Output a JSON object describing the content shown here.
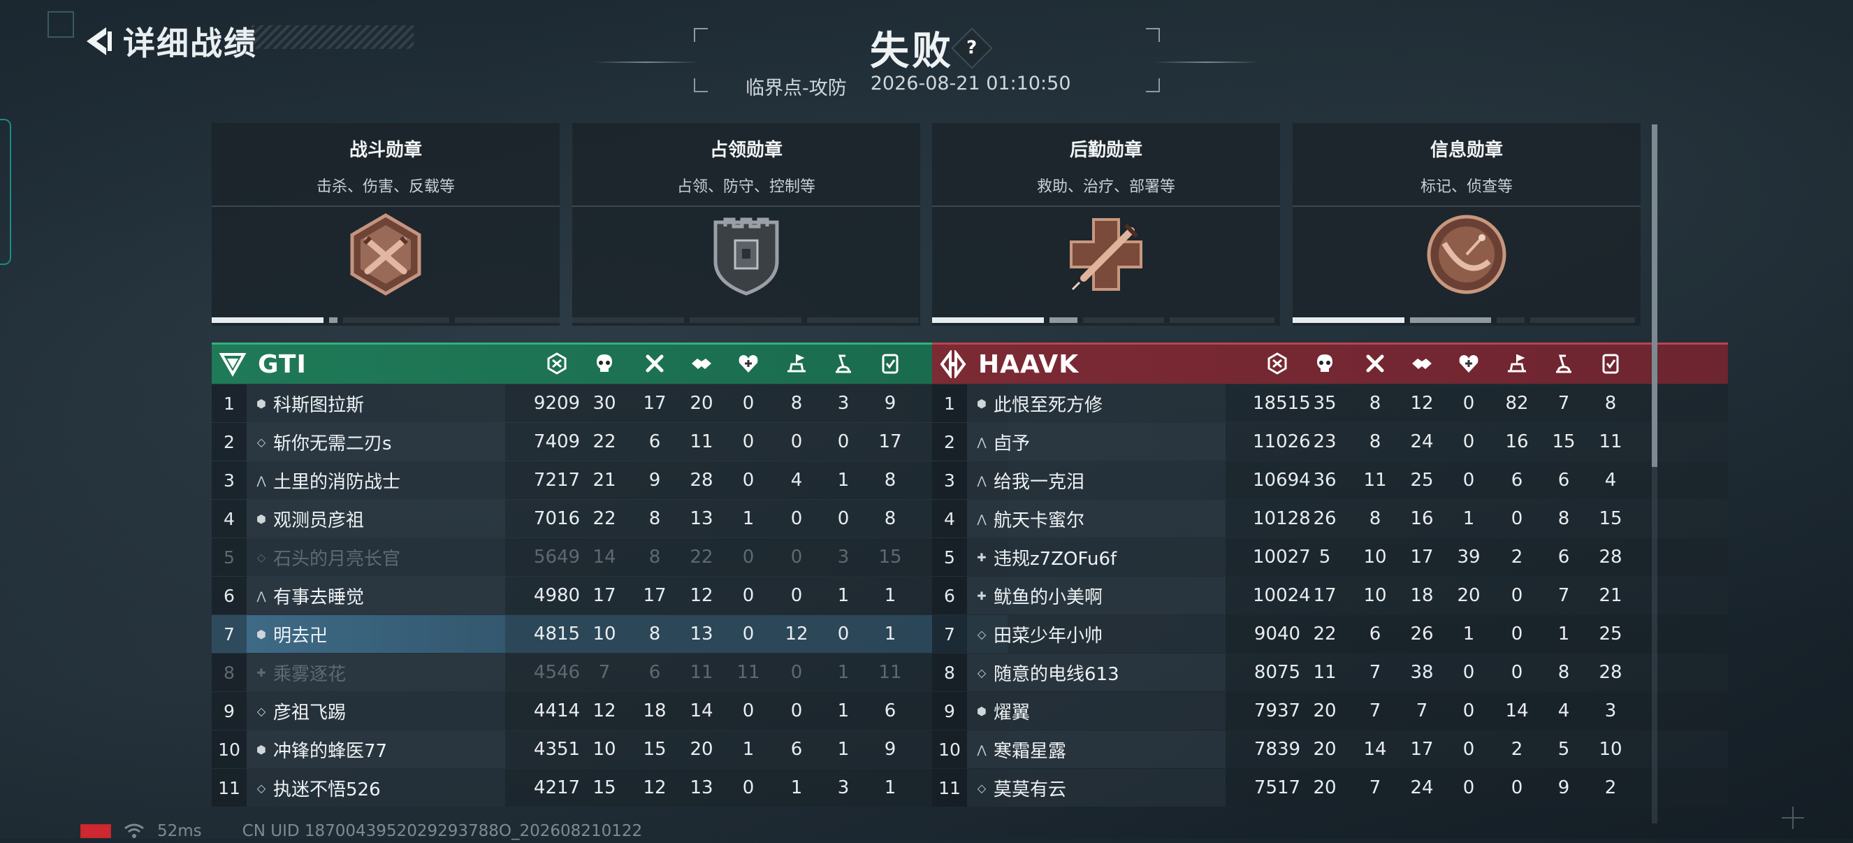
{
  "header": {
    "back_label": "详细战绩",
    "result": "失败",
    "help": "?",
    "mode": "临界点-攻防",
    "datetime": "2026-08-21 01:10:50"
  },
  "medals": [
    {
      "title": "战斗勋章",
      "desc": "击杀、伤害、反载等",
      "icon": "crossed-swords-hexagon-icon",
      "color": "#b8826a"
    },
    {
      "title": "占领勋章",
      "desc": "占领、防守、控制等",
      "icon": "fortress-shield-icon",
      "color": "#8a9096"
    },
    {
      "title": "后勤勋章",
      "desc": "救助、治疗、部署等",
      "icon": "medical-cross-syringe-icon",
      "color": "#b8826a"
    },
    {
      "title": "信息勋章",
      "desc": "标记、侦查等",
      "icon": "radar-dish-icon",
      "color": "#b8826a"
    }
  ],
  "stat_columns": [
    "score-icon",
    "kills-icon",
    "deaths-icon",
    "assists-icon",
    "revives-icon",
    "captures-icon",
    "vehicles-icon",
    "other-icon"
  ],
  "teams": [
    {
      "name": "GTI",
      "logo": "triangle-v-logo-icon",
      "color": "#1f7a58",
      "players": [
        {
          "rank": "1",
          "cls": "⬢",
          "name": "科斯图拉斯",
          "stats": [
            "9209",
            "30",
            "17",
            "20",
            "0",
            "8",
            "3",
            "9"
          ]
        },
        {
          "rank": "2",
          "cls": "◇",
          "name": "斩你无需二刃s",
          "stats": [
            "7409",
            "22",
            "6",
            "11",
            "0",
            "0",
            "0",
            "17"
          ]
        },
        {
          "rank": "3",
          "cls": "⋀",
          "name": "土里的消防战士",
          "stats": [
            "7217",
            "21",
            "9",
            "28",
            "0",
            "4",
            "1",
            "8"
          ]
        },
        {
          "rank": "4",
          "cls": "⬢",
          "name": "观测员彦祖",
          "stats": [
            "7016",
            "22",
            "8",
            "13",
            "1",
            "0",
            "0",
            "8"
          ]
        },
        {
          "rank": "5",
          "cls": "◇",
          "name": "石头的月亮长官",
          "stats": [
            "5649",
            "14",
            "8",
            "22",
            "0",
            "0",
            "3",
            "15"
          ],
          "dim": true
        },
        {
          "rank": "6",
          "cls": "⋀",
          "name": "有事去睡觉",
          "stats": [
            "4980",
            "17",
            "17",
            "12",
            "0",
            "0",
            "1",
            "1"
          ]
        },
        {
          "rank": "7",
          "cls": "⬢",
          "name": "明去卍",
          "stats": [
            "4815",
            "10",
            "8",
            "13",
            "0",
            "12",
            "0",
            "1"
          ],
          "me": true
        },
        {
          "rank": "8",
          "cls": "✚",
          "name": "乘雾逐花",
          "stats": [
            "4546",
            "7",
            "6",
            "11",
            "11",
            "0",
            "1",
            "11"
          ],
          "dim": true
        },
        {
          "rank": "9",
          "cls": "◇",
          "name": "彦祖飞踢",
          "stats": [
            "4414",
            "12",
            "18",
            "14",
            "0",
            "0",
            "1",
            "6"
          ]
        },
        {
          "rank": "10",
          "cls": "⬢",
          "name": "冲锋的蜂医77",
          "stats": [
            "4351",
            "10",
            "15",
            "20",
            "1",
            "6",
            "1",
            "9"
          ]
        },
        {
          "rank": "11",
          "cls": "◇",
          "name": "执迷不悟526",
          "stats": [
            "4217",
            "15",
            "12",
            "13",
            "0",
            "1",
            "3",
            "1"
          ]
        }
      ]
    },
    {
      "name": "HAAVK",
      "logo": "split-diamond-logo-icon",
      "color": "#7c2a34",
      "players": [
        {
          "rank": "1",
          "cls": "⬢",
          "name": "此恨至死方修",
          "stats": [
            "18515",
            "35",
            "8",
            "12",
            "0",
            "82",
            "7",
            "8"
          ]
        },
        {
          "rank": "2",
          "cls": "⋀",
          "name": "卣予",
          "stats": [
            "11026",
            "23",
            "8",
            "24",
            "0",
            "16",
            "15",
            "11"
          ]
        },
        {
          "rank": "3",
          "cls": "⋀",
          "name": "给我一克泪",
          "stats": [
            "10694",
            "36",
            "11",
            "25",
            "0",
            "6",
            "6",
            "4"
          ]
        },
        {
          "rank": "4",
          "cls": "⋀",
          "name": "航天卡蜜尔",
          "stats": [
            "10128",
            "26",
            "8",
            "16",
            "1",
            "0",
            "8",
            "15"
          ]
        },
        {
          "rank": "5",
          "cls": "✚",
          "name": "违规z7ZOFu6f",
          "stats": [
            "10027",
            "5",
            "10",
            "17",
            "39",
            "2",
            "6",
            "28"
          ]
        },
        {
          "rank": "6",
          "cls": "✚",
          "name": "鱿鱼的小美啊",
          "stats": [
            "10024",
            "17",
            "10",
            "18",
            "20",
            "0",
            "7",
            "21"
          ]
        },
        {
          "rank": "7",
          "cls": "◇",
          "name": "田菜少年小帅",
          "stats": [
            "9040",
            "22",
            "6",
            "26",
            "1",
            "0",
            "1",
            "25"
          ]
        },
        {
          "rank": "8",
          "cls": "◇",
          "name": "随意的电线613",
          "stats": [
            "8075",
            "11",
            "7",
            "38",
            "0",
            "0",
            "8",
            "28"
          ]
        },
        {
          "rank": "9",
          "cls": "⬢",
          "name": "燿翼",
          "stats": [
            "7937",
            "20",
            "7",
            "7",
            "0",
            "14",
            "4",
            "3"
          ]
        },
        {
          "rank": "10",
          "cls": "⋀",
          "name": "寒霜星露",
          "stats": [
            "7839",
            "20",
            "14",
            "17",
            "0",
            "2",
            "5",
            "10"
          ]
        },
        {
          "rank": "11",
          "cls": "◇",
          "name": "莫莫有云",
          "stats": [
            "7517",
            "20",
            "7",
            "24",
            "0",
            "0",
            "9",
            "2"
          ]
        }
      ]
    }
  ],
  "footer": {
    "ping": "52ms",
    "uid": "CN UID 1870043952029293788O_202608210122"
  }
}
